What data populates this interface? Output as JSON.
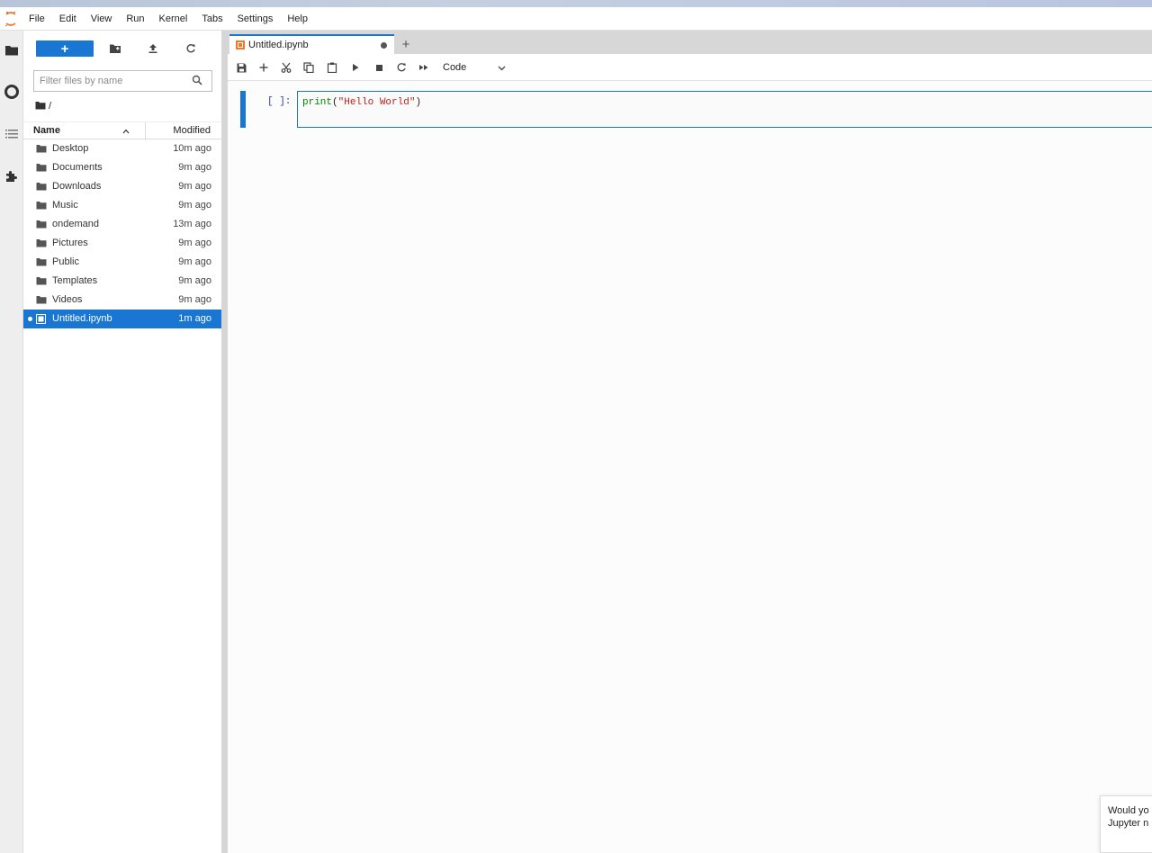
{
  "menubar": {
    "items": [
      "File",
      "Edit",
      "View",
      "Run",
      "Kernel",
      "Tabs",
      "Settings",
      "Help"
    ]
  },
  "iconbar": {
    "icons": [
      "folder-icon",
      "running-icon",
      "toc-icon",
      "extension-icon"
    ]
  },
  "filebrowser": {
    "new_label": "+",
    "filter_placeholder": "Filter files by name",
    "breadcrumb": "/",
    "columns": {
      "name": "Name",
      "modified": "Modified"
    },
    "items": [
      {
        "name": "Desktop",
        "modified": "10m ago",
        "type": "folder"
      },
      {
        "name": "Documents",
        "modified": "9m ago",
        "type": "folder"
      },
      {
        "name": "Downloads",
        "modified": "9m ago",
        "type": "folder"
      },
      {
        "name": "Music",
        "modified": "9m ago",
        "type": "folder"
      },
      {
        "name": "ondemand",
        "modified": "13m ago",
        "type": "folder"
      },
      {
        "name": "Pictures",
        "modified": "9m ago",
        "type": "folder"
      },
      {
        "name": "Public",
        "modified": "9m ago",
        "type": "folder"
      },
      {
        "name": "Templates",
        "modified": "9m ago",
        "type": "folder"
      },
      {
        "name": "Videos",
        "modified": "9m ago",
        "type": "folder"
      },
      {
        "name": "Untitled.ipynb",
        "modified": "1m ago",
        "type": "notebook",
        "selected": true
      }
    ]
  },
  "notebook": {
    "tab_title": "Untitled.ipynb",
    "add_tab_label": "+",
    "cell_type": "Code",
    "cell": {
      "prompt": "[ ]:",
      "code_fn": "print",
      "code_open": "(",
      "code_str": "\"Hello World\"",
      "code_close": ")"
    }
  },
  "toast": {
    "line1": "Would yo",
    "line2": "Jupyter n"
  },
  "colors": {
    "accent": "#1976d2",
    "selected_row": "#1976d2"
  }
}
